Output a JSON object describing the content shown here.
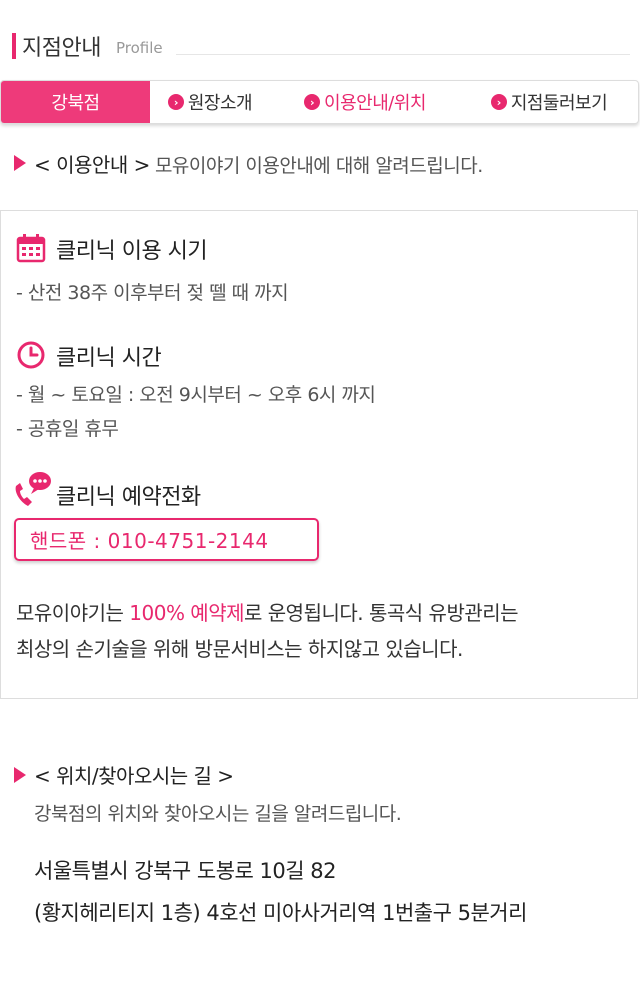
{
  "header": {
    "title": "지점안내",
    "subtitle": "Profile"
  },
  "tabs": [
    {
      "label": "강북점",
      "active": true
    },
    {
      "label": "원장소개",
      "active": false
    },
    {
      "label": "이용안내/위치",
      "active": false,
      "highlight": true
    },
    {
      "label": "지점둘러보기",
      "active": false
    }
  ],
  "usage": {
    "heading": "< 이용안내 >",
    "desc": "모유이야기 이용안내에 대해 알려드립니다."
  },
  "clinic_period": {
    "title": "클리닉 이용 시기",
    "lines": [
      "- 산전 38주 이후부터 젖 뗄 때 까지"
    ]
  },
  "clinic_hours": {
    "title": "클리닉 시간",
    "lines": [
      "- 월 ~ 토요일 : 오전 9시부터 ~ 오후 6시 까지",
      "- 공휴일 휴무"
    ]
  },
  "clinic_phone": {
    "title": "클리닉 예약전화",
    "phone": "핸드폰 : 010-4751-2144"
  },
  "notice": {
    "part1": "모유이야기는 ",
    "highlight": "100% 예약제",
    "part2": "로 운영됩니다. 통곡식 유방관리는",
    "line2": "최상의 손기술을 위해 방문서비스는 하지않고 있습니다."
  },
  "location": {
    "heading": "< 위치/찾아오시는 길 >",
    "desc": "강북점의 위치와 찾아오시는 길을 알려드립니다.",
    "address1": "서울특별시 강북구 도봉로 10길 82",
    "address2": "(황지헤리티지 1층) 4호선 미아사거리역 1번출구 5분거리"
  },
  "colors": {
    "accent": "#e8286e",
    "tab_active": "#ee3a7a"
  },
  "icons": [
    "calendar-icon",
    "clock-icon",
    "phone-chat-icon",
    "chevron-right-icon",
    "triangle-bullet-icon"
  ]
}
